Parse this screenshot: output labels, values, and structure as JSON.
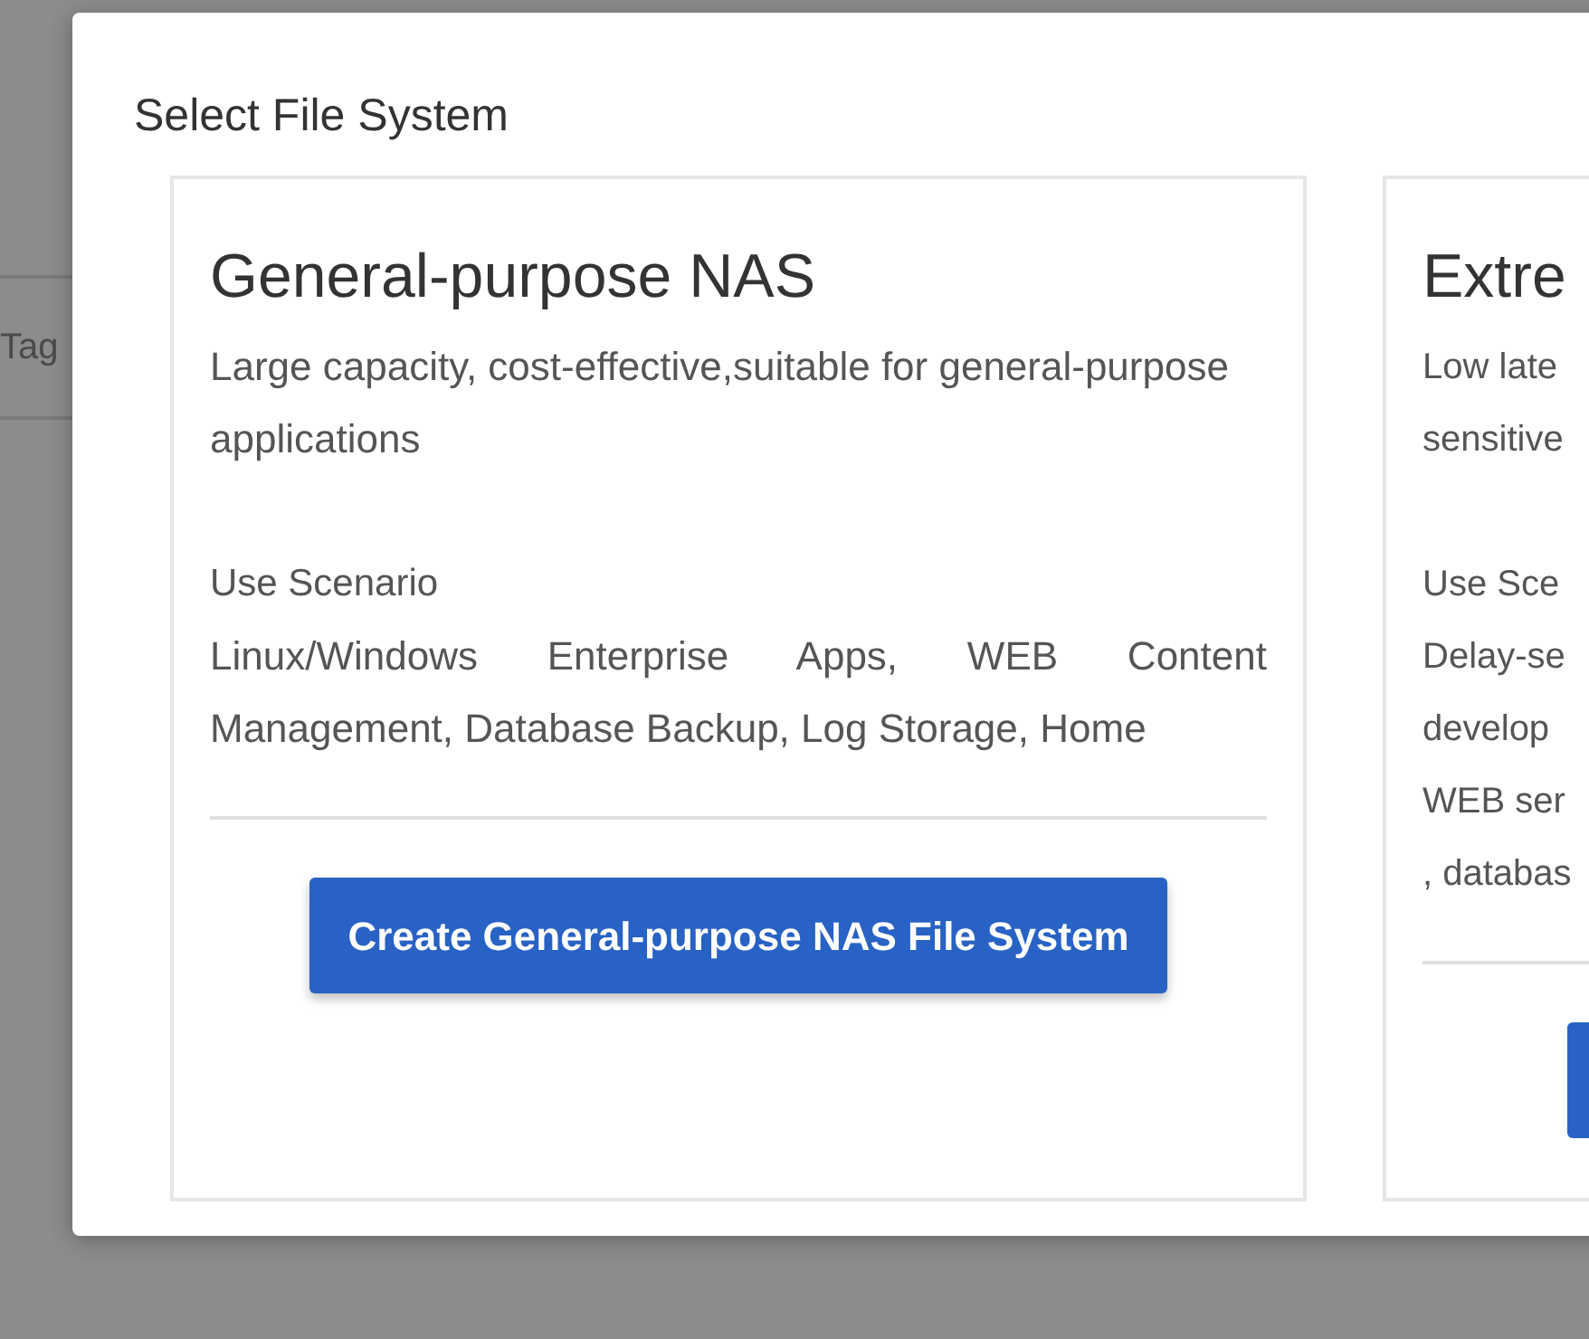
{
  "background": {
    "tag_field": {
      "placeholder": "Tag"
    }
  },
  "dialog": {
    "title": "Select File System",
    "cards": [
      {
        "kind": "full",
        "title": "General-purpose NAS",
        "description": "Large capacity, cost-effective,suitable for general-purpose\napplications",
        "scenario_label": "Use Scenario",
        "scenario": "Linux/Windows Enterprise Apps, WEB Content Management, Database Backup, Log Storage, Home",
        "button": "Create General-purpose NAS File System"
      },
      {
        "kind": "clipped",
        "title": "Extre",
        "description_lines": [
          "Low late",
          "sensitive"
        ],
        "scenario_label": "Use Sce",
        "scenario_lines": [
          "Delay-se",
          "develop",
          "WEB ser",
          ", databas"
        ]
      }
    ]
  }
}
